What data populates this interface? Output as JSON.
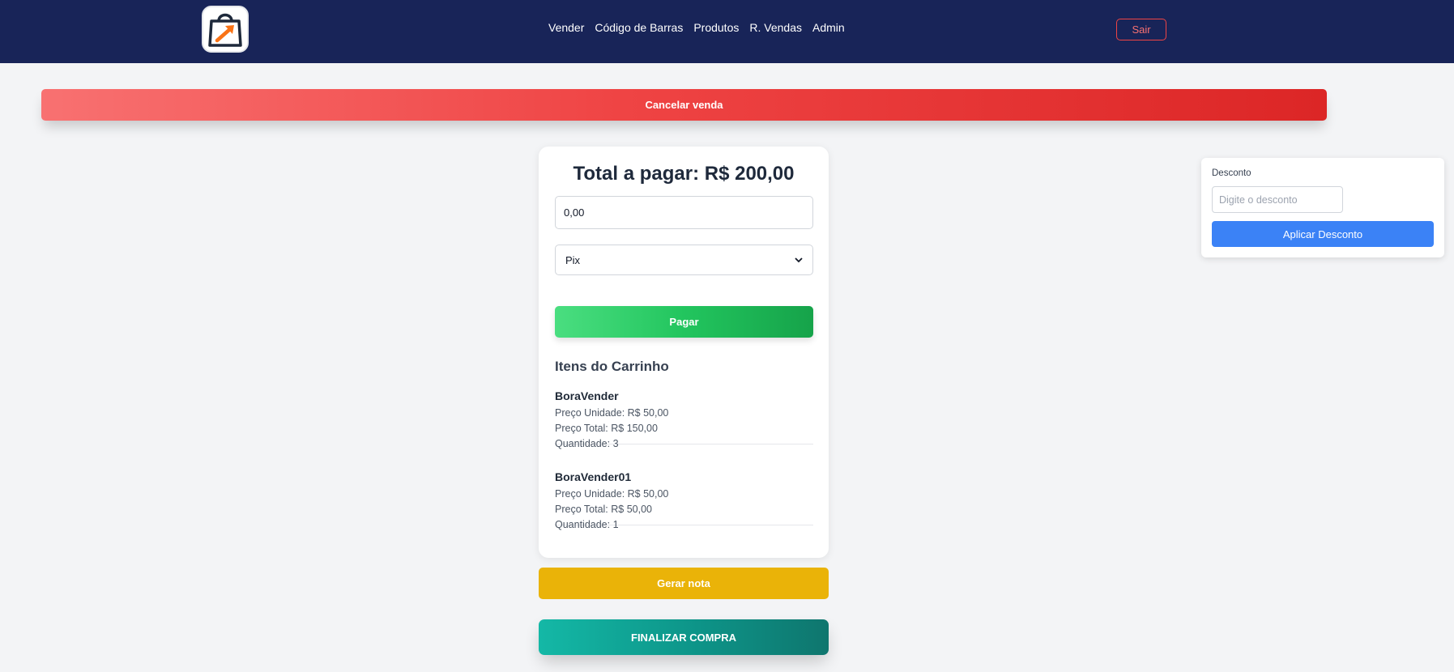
{
  "nav": {
    "links": [
      "Vender",
      "Código de Barras",
      "Produtos",
      "R. Vendas",
      "Admin"
    ],
    "logout_label": "Sair"
  },
  "actions": {
    "cancel_label": "Cancelar venda",
    "generate_note_label": "Gerar nota",
    "finish_label": "FINALIZAR COMPRA"
  },
  "payment": {
    "total_label": "Total a pagar: R$ 200,00",
    "amount_value": "0,00",
    "method_selected": "Pix",
    "pay_label": "Pagar"
  },
  "cart": {
    "heading": "Itens do Carrinho",
    "items": [
      {
        "name": "BoraVender",
        "unit_price": "Preço Unidade: R$ 50,00",
        "total_price": "Preço Total: R$ 150,00",
        "quantity": "Quantidade: 3"
      },
      {
        "name": "BoraVender01",
        "unit_price": "Preço Unidade: R$ 50,00",
        "total_price": "Preço Total: R$ 50,00",
        "quantity": "Quantidade: 1"
      }
    ]
  },
  "discount": {
    "label": "Desconto",
    "placeholder": "Digite o desconto",
    "apply_label": "Aplicar Desconto"
  },
  "colors": {
    "navbar": "#182458",
    "danger": "#ef4444",
    "success": "#22c55e",
    "warning": "#eab308",
    "teal": "#0d9488",
    "primary": "#3b82f6"
  },
  "icons": {
    "logo": "shopping-bag-arrow-icon",
    "select_caret": "chevron-down-icon"
  }
}
